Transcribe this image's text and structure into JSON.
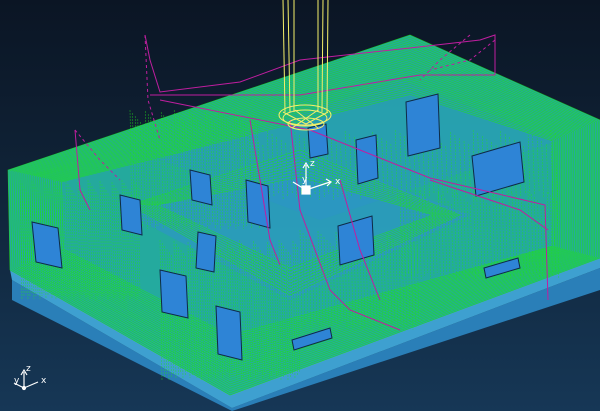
{
  "viewport": {
    "background_top": "#0b1524",
    "background_bottom": "#163756",
    "toolpath_color": "#21e21a",
    "rapid_color": "#c01ea0",
    "tool_color": "#f5f06a",
    "part_color": "#1fb0a3",
    "base_color": "#2a7fb8"
  },
  "tool_axes": {
    "x": "x",
    "y": "y",
    "z": "z"
  },
  "view_triad": {
    "x": "x",
    "y": "y",
    "z": "z"
  }
}
